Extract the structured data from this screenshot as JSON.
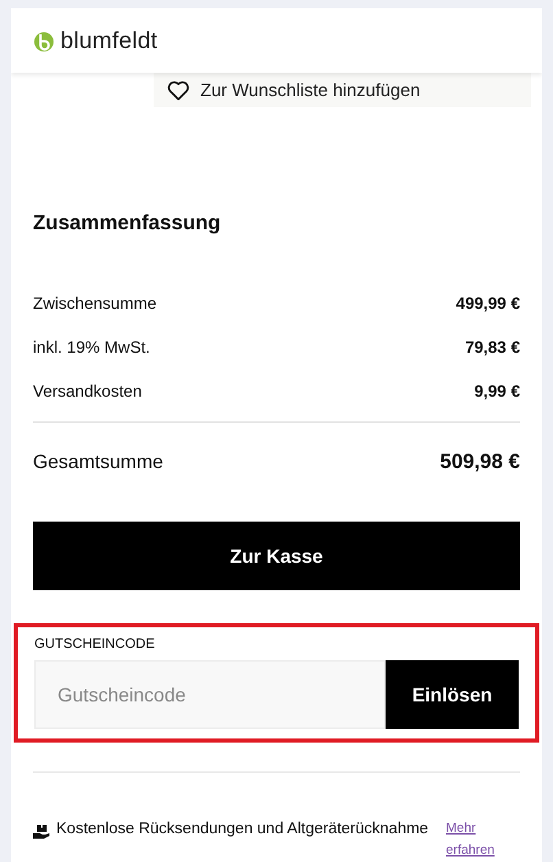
{
  "header": {
    "logo_text": "blumfeldt"
  },
  "wishlist_button": {
    "label": "Zur Wunschliste hinzufügen"
  },
  "summary": {
    "title": "Zusammenfassung",
    "rows": [
      {
        "label": "Zwischensumme",
        "value": "499,99 €"
      },
      {
        "label": "inkl. 19% MwSt.",
        "value": "79,83 €"
      },
      {
        "label": "Versandkosten",
        "value": "9,99 €"
      }
    ],
    "total": {
      "label": "Gesamtsumme",
      "value": "509,98 €"
    },
    "checkout_button": "Zur Kasse"
  },
  "voucher": {
    "label": "GUTSCHEINCODE",
    "placeholder": "Gutscheincode",
    "button": "Einlösen"
  },
  "info": {
    "text": "Kostenlose Rücksendungen und Altgeräterücknahme",
    "link": "Mehr erfahren"
  }
}
